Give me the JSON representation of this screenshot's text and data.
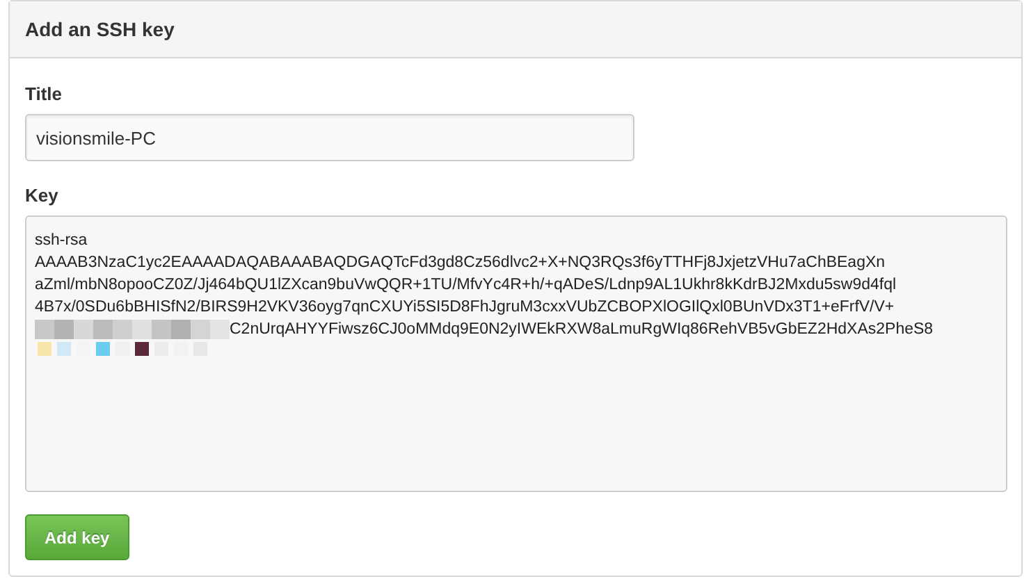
{
  "panel": {
    "title": "Add an SSH key"
  },
  "title_field": {
    "label": "Title",
    "value": "visionsmile-PC"
  },
  "key_field": {
    "label": "Key",
    "lines": [
      {
        "text": "ssh-rsa",
        "redacted": false
      },
      {
        "text": "AAAAB3NzaC1yc2EAAAADAQABAAABAQDGAQTcFd3gd8Cz56dlvc2+X+NQ3RQs3f6yTTHFj8JxjetzVHu7aChBEagXn",
        "redacted": false
      },
      {
        "text": "aZml/mbN8opooCZ0Z/Jj464bQU1lZXcan9buVwQQR+1TU/MfvYc4R+h/+qADeS/Ldnp9AL1Ukhr8kKdrBJ2Mxdu5sw9d4fql",
        "redacted": false
      },
      {
        "text": "4B7x/0SDu6bBHISfN2/BIRS9H2VKV36oyg7qnCXUYi5SI5D8FhJgruM3cxxVUbZCBOPXlOGIlQxl0BUnVDx3T1+eFrfV/V+",
        "redacted": false
      },
      {
        "text": "C2nUrqAHYYFiwsz6CJ0oMMdq9E0N2yIWEkRXW8aLmuRgWIq86RehVB5vGbEZ2HdXAs2PheS8",
        "redacted": true
      }
    ]
  },
  "button": {
    "label": "Add key"
  }
}
